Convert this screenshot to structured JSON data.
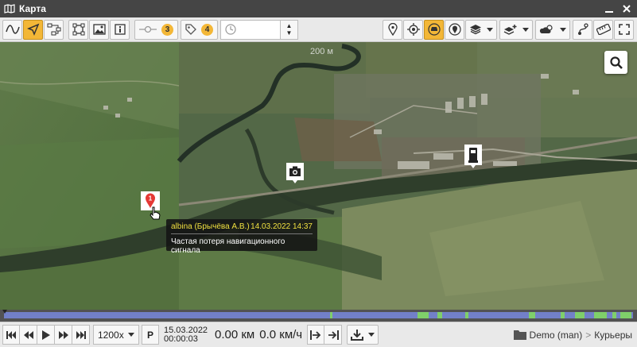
{
  "window": {
    "title": "Карта"
  },
  "toolbar": {
    "points_count": "3",
    "tags_count": "4",
    "time_value": ""
  },
  "map": {
    "scale_label": "200 м",
    "tooltip": {
      "unit": "albina (Брычёва А.В.)",
      "datetime": "14.03.2022 14:37",
      "message": "Частая потеря навигационного сигнала"
    },
    "marker_number": "1"
  },
  "timeline": {
    "colors": {
      "track": "#7280c8",
      "active": "#7fcf6a"
    }
  },
  "player": {
    "speed": "1200x",
    "p_label": "P",
    "date": "15.03.2022",
    "time": "00:00:03",
    "distance": "0.00 км",
    "velocity": "0.0 км/ч",
    "account": "Demo (man)",
    "separator": ">",
    "group": "Курьеры"
  },
  "colors": {
    "accent": "#f3b737",
    "titlebar": "#454545"
  }
}
